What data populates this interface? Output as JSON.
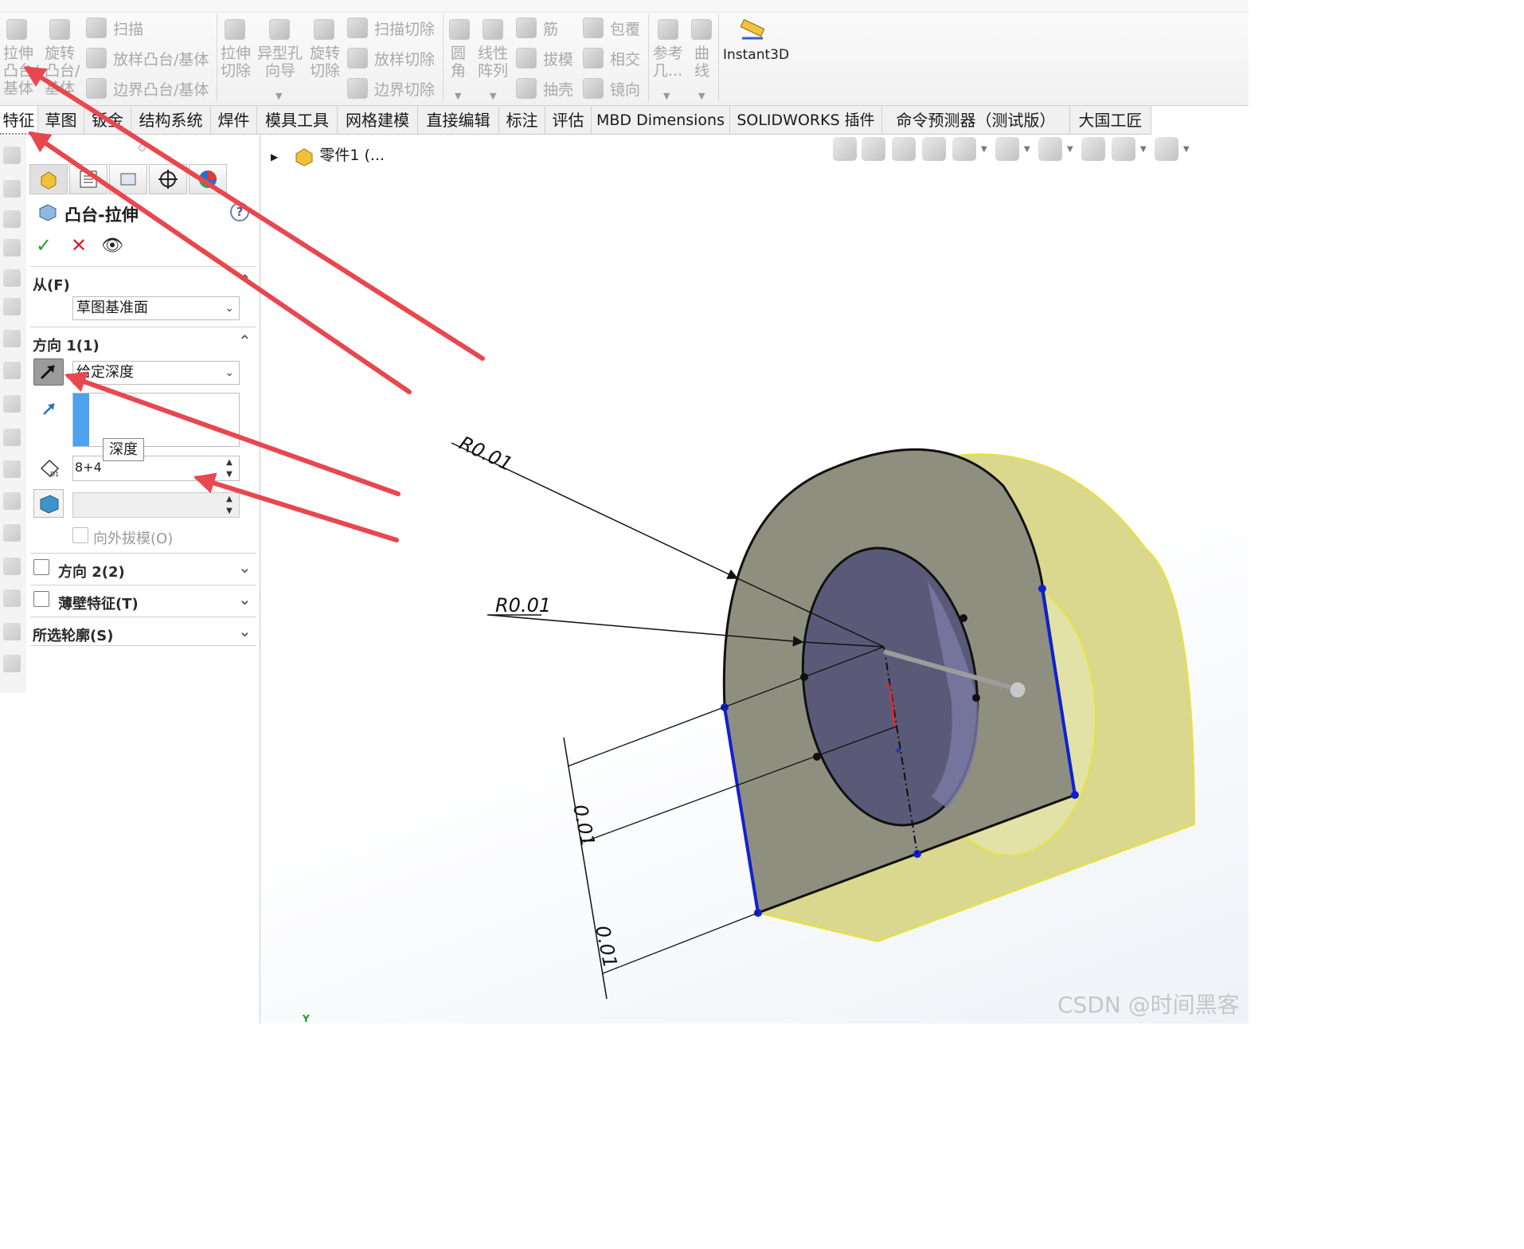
{
  "ribbon": {
    "features": {
      "extrude_boss": [
        "拉伸",
        "凸台/",
        "基体"
      ],
      "revolve_boss": [
        "旋转",
        "凸台/",
        "基体"
      ],
      "sweep": "扫描",
      "loft_boss": "放样凸台/基体",
      "boundary_boss": "边界凸台/基体",
      "extrude_cut": [
        "拉伸",
        "切除"
      ],
      "hole_wizard": [
        "异型孔",
        "向导"
      ],
      "revolve_cut": [
        "旋转",
        "切除"
      ],
      "swept_cut": "扫描切除",
      "lofted_cut": "放样切除",
      "boundary_cut": "边界切除",
      "fillet": [
        "圆",
        "角"
      ],
      "linear_pattern": [
        "线性",
        "阵列"
      ],
      "rib": "筋",
      "draft": "拔模",
      "shell": "抽壳",
      "wrap": "包覆",
      "intersect": "相交",
      "mirror": "镜向",
      "ref_geometry": [
        "参考",
        "几..."
      ],
      "curves": [
        "曲",
        "线"
      ],
      "instant3d": "Instant3D"
    }
  },
  "tabs": [
    "特征",
    "草图",
    "钣金",
    "结构系统",
    "焊件",
    "模具工具",
    "网格建模",
    "直接编辑",
    "标注",
    "评估",
    "MBD Dimensions",
    "SOLIDWORKS 插件",
    "命令预测器（测试版）",
    "大国工匠"
  ],
  "property_manager": {
    "title": "凸台-拉伸",
    "help": "?",
    "ok": "✓",
    "cancel": "✕",
    "preview": "👁",
    "from_section": "从(F)",
    "from_value": "草图基准面",
    "direction1_section": "方向 1(1)",
    "end_condition": "给定深度",
    "depth_value": "8+4",
    "depth_tooltip": "深度",
    "draft_outward": "向外拔模(O)",
    "direction2_section": "方向 2(2)",
    "thin_feature_section": "薄壁特征(T)",
    "selected_contours_section": "所选轮廓(S)"
  },
  "viewport": {
    "tree_label": "零件1 (...",
    "dim_r1": "R0.01",
    "dim_r2": "R0.01",
    "dim_l1": "0.01",
    "dim_l2": "0.01",
    "axis_label": "Y"
  },
  "watermark": "CSDN @时间黑客",
  "colors": {
    "annotation_arrow": "#e8474f",
    "highlight_edge": "#1020d0",
    "part_face": "#8e8e7e",
    "part_side": "#d8d78a"
  }
}
